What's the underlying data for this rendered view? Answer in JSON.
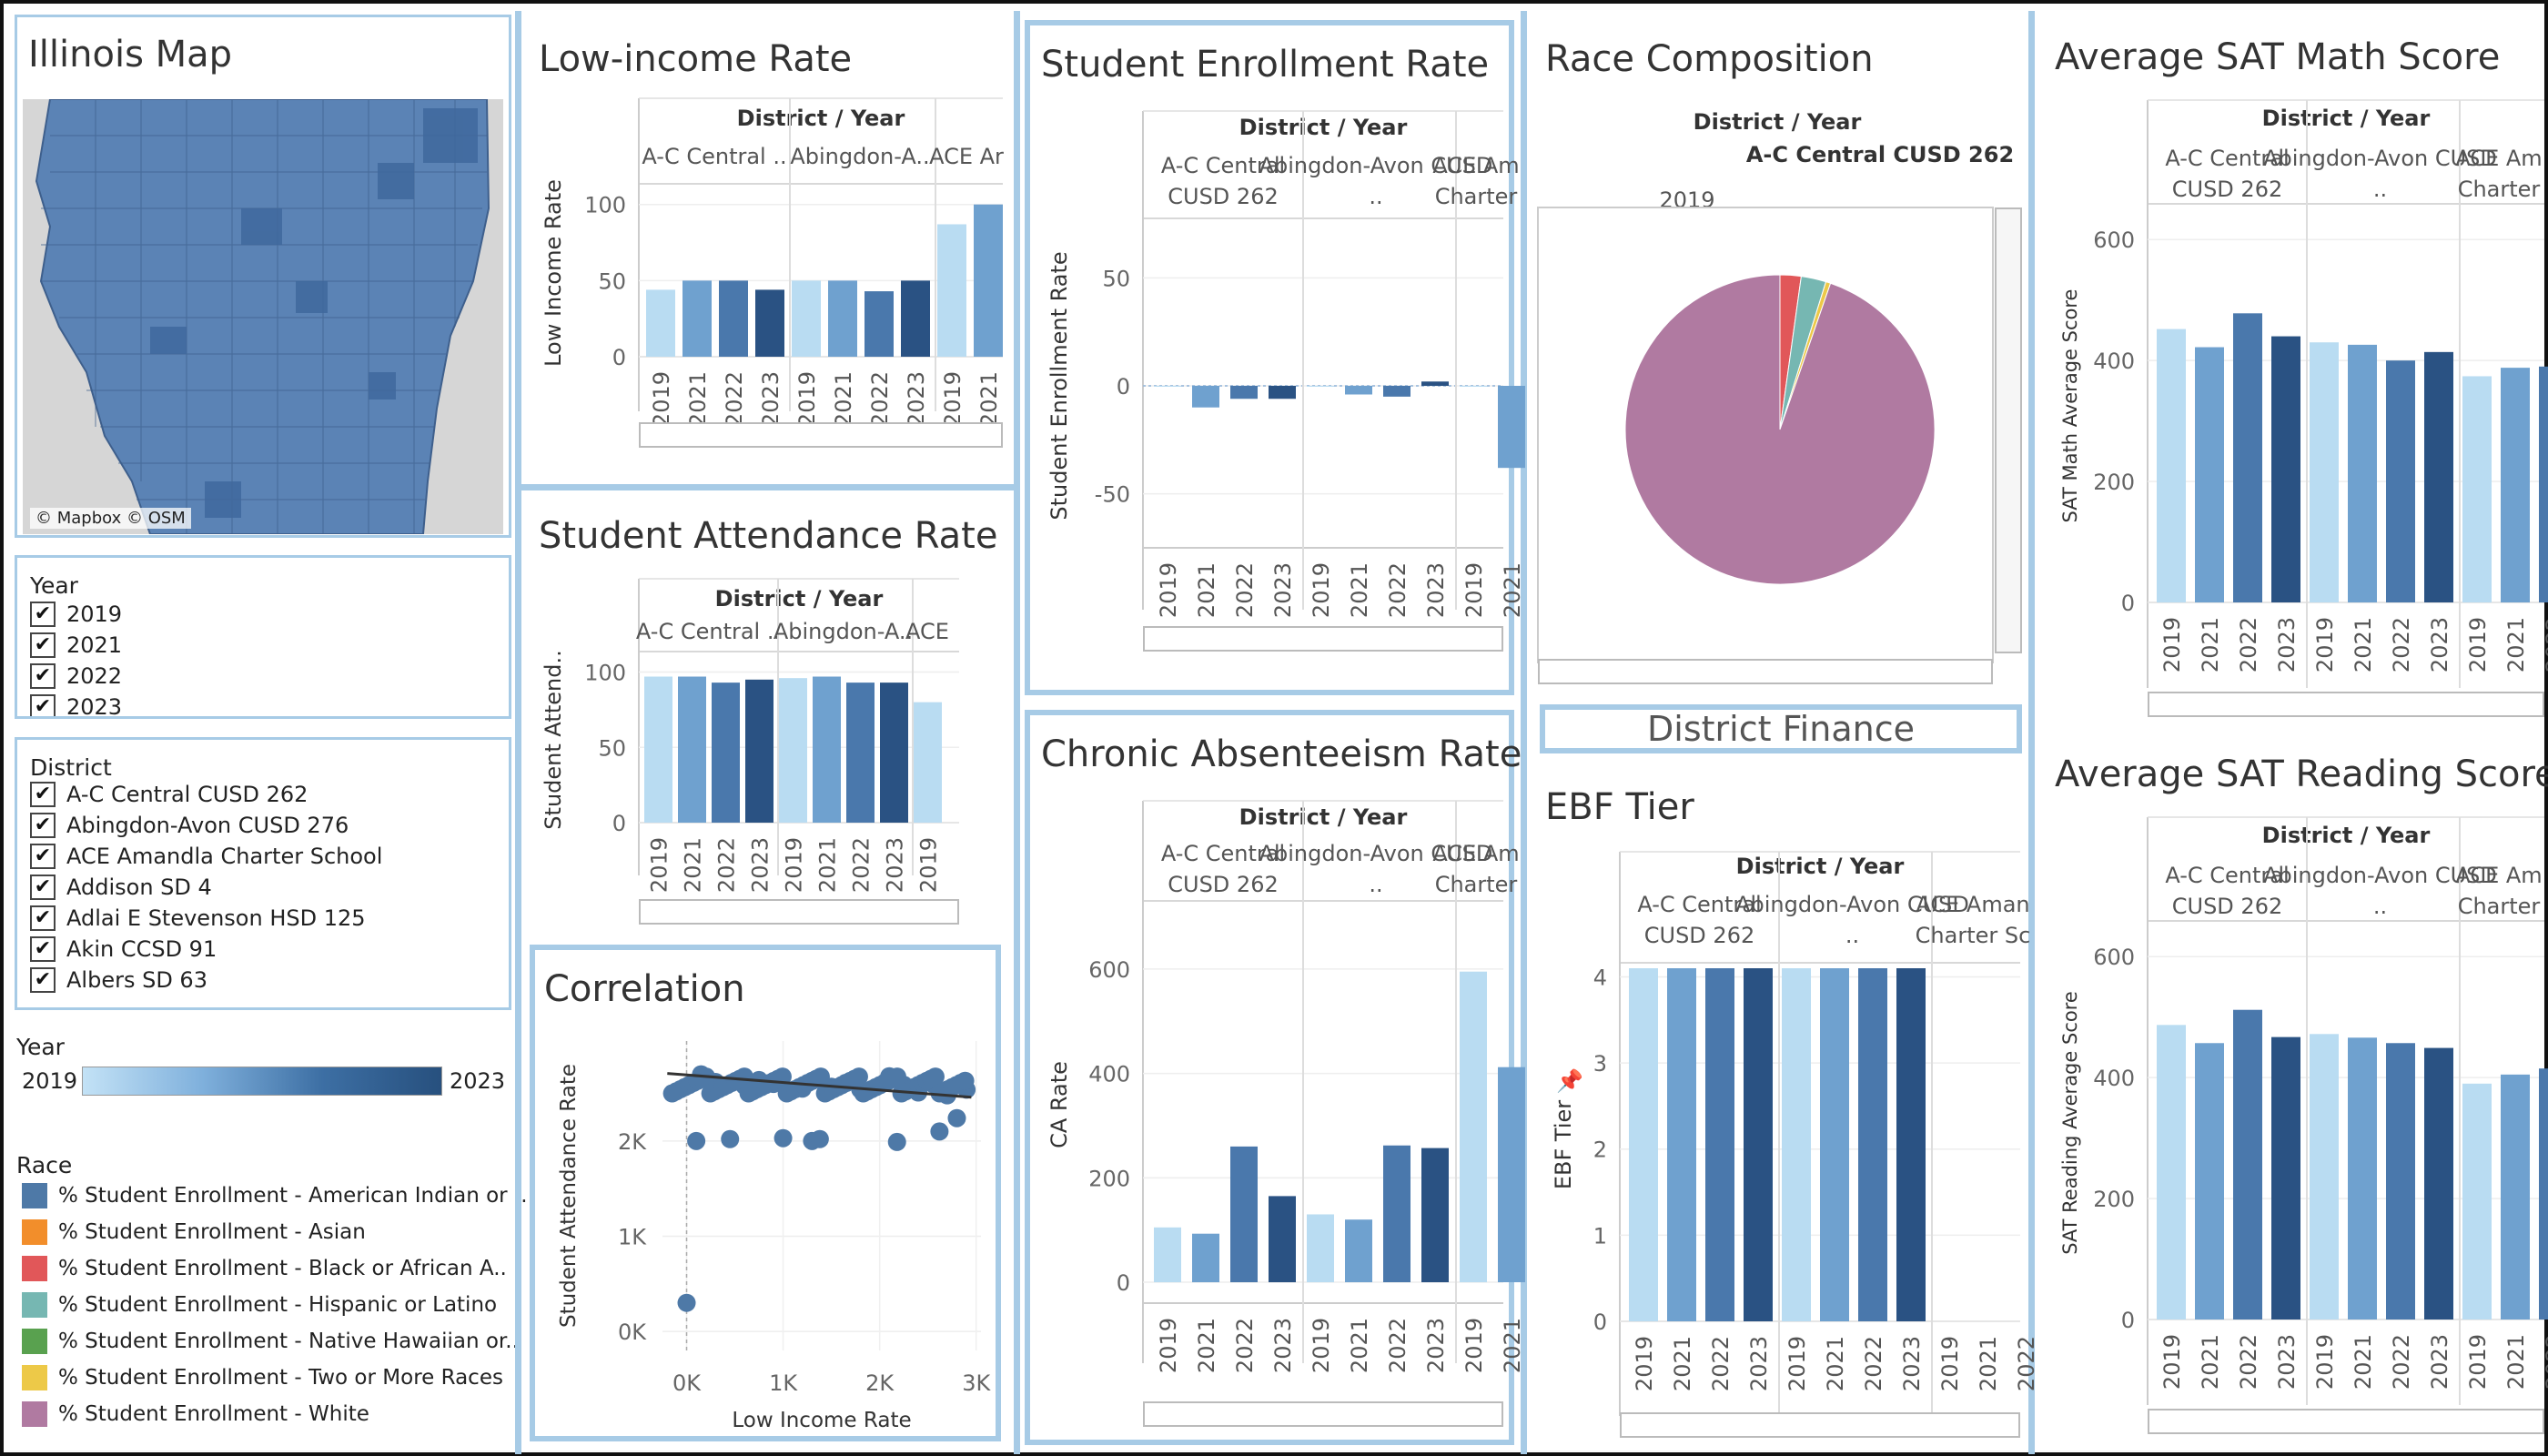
{
  "map": {
    "title": "Illinois Map",
    "attribution": "© Mapbox © OSM"
  },
  "year_filter": {
    "title": "Year",
    "items": [
      "2019",
      "2021",
      "2022",
      "2023"
    ]
  },
  "district_filter": {
    "title": "District",
    "items": [
      "A-C Central CUSD 262",
      "Abingdon-Avon CUSD 276",
      "ACE Amandla Charter School",
      "Addison SD 4",
      "Adlai E Stevenson HSD 125",
      "Akin CCSD 91",
      "Albers SD 63"
    ]
  },
  "year_legend": {
    "title": "Year",
    "min": "2019",
    "max": "2023"
  },
  "race_legend": {
    "title": "Race",
    "items": [
      {
        "label": "% Student Enrollment - American Indian or ..",
        "color": "#4e79a7"
      },
      {
        "label": "% Student Enrollment - Asian",
        "color": "#f28e2b"
      },
      {
        "label": "% Student Enrollment - Black or African A..",
        "color": "#e15759"
      },
      {
        "label": "% Student Enrollment - Hispanic or Latino",
        "color": "#76b7b2"
      },
      {
        "label": "% Student Enrollment - Native Hawaiian or..",
        "color": "#59a14f"
      },
      {
        "label": "% Student Enrollment - Two or More Races",
        "color": "#edc948"
      },
      {
        "label": "% Student Enrollment - White",
        "color": "#b07aa1"
      }
    ]
  },
  "year_colors": {
    "2019": "#b9dcf2",
    "2021": "#6fa1cf",
    "2022": "#4a78ac",
    "2023": "#2a5283"
  },
  "common": {
    "header": "District / Year"
  },
  "finance_button": {
    "label": "District Finance"
  },
  "chart_data": [
    {
      "id": "lowinc",
      "type": "bar",
      "title": "Low-income Rate",
      "ylabel": "Low Income Rate",
      "ylim": [
        0,
        110
      ],
      "yticks": [
        0,
        50,
        100
      ],
      "groups": [
        {
          "label": "A-C Central ..",
          "years": [
            "2019",
            "2021",
            "2022",
            "2023"
          ],
          "values": [
            44,
            50,
            50,
            44
          ]
        },
        {
          "label": "Abingdon-A..",
          "years": [
            "2019",
            "2021",
            "2022",
            "2023"
          ],
          "values": [
            50,
            50,
            43,
            50
          ]
        },
        {
          "label": "ACE Ar",
          "years": [
            "2019",
            "2021"
          ],
          "values": [
            87,
            100
          ]
        }
      ]
    },
    {
      "id": "attend",
      "type": "bar",
      "title": "Student Attendance Rate",
      "ylabel": "Student Attend..",
      "ylim": [
        0,
        110
      ],
      "yticks": [
        0,
        50,
        100
      ],
      "groups": [
        {
          "label": "A-C Central ..",
          "years": [
            "2019",
            "2021",
            "2022",
            "2023"
          ],
          "values": [
            97,
            97,
            93,
            95
          ]
        },
        {
          "label": "Abingdon-A..",
          "years": [
            "2019",
            "2021",
            "2022",
            "2023"
          ],
          "values": [
            96,
            97,
            93,
            93
          ]
        },
        {
          "label": "ACE",
          "years": [
            "2019"
          ],
          "values": [
            80
          ]
        }
      ]
    },
    {
      "id": "enroll",
      "type": "bar",
      "title": "Student Enrollment Rate",
      "ylabel": "Student Enrollment Rate",
      "ylim": [
        -75,
        75
      ],
      "yticks": [
        -50,
        0,
        50
      ],
      "groups": [
        {
          "label": "A-C Central CUSD 262",
          "years": [
            "2019",
            "2021",
            "2022",
            "2023"
          ],
          "values": [
            0,
            -10,
            -6,
            -6
          ]
        },
        {
          "label": "Abingdon-Avon CUSD ..",
          "years": [
            "2019",
            "2021",
            "2022",
            "2023"
          ],
          "values": [
            0,
            -4,
            -5,
            2
          ]
        },
        {
          "label": "ACE Am Charter",
          "years": [
            "2019",
            "2021"
          ],
          "values": [
            0,
            -38
          ]
        }
      ]
    },
    {
      "id": "chronic",
      "type": "bar",
      "title": "Chronic Absenteeism Rate",
      "ylabel": "CA Rate",
      "ylim": [
        -40,
        720
      ],
      "yticks": [
        0,
        200,
        400,
        600
      ],
      "groups": [
        {
          "label": "A-C Central CUSD 262",
          "years": [
            "2019",
            "2021",
            "2022",
            "2023"
          ],
          "values": [
            105,
            93,
            260,
            165
          ]
        },
        {
          "label": "Abingdon-Avon CUSD ..",
          "years": [
            "2019",
            "2021",
            "2022",
            "2023"
          ],
          "values": [
            130,
            120,
            262,
            257
          ]
        },
        {
          "label": "ACE Am Charter",
          "years": [
            "2019",
            "2021"
          ],
          "values": [
            595,
            412
          ]
        }
      ]
    },
    {
      "id": "ebf",
      "type": "bar",
      "title": "EBF Tier",
      "ylabel": "EBF Tier",
      "ylim": [
        0,
        4.1
      ],
      "yticks": [
        0,
        1,
        2,
        3,
        4
      ],
      "groups": [
        {
          "label": "A-C Central CUSD 262",
          "years": [
            "2019",
            "2021",
            "2022",
            "2023"
          ],
          "values": [
            4.1,
            4.1,
            4.1,
            4.1
          ]
        },
        {
          "label": "Abingdon-Avon CUSD ..",
          "years": [
            "2019",
            "2021",
            "2022",
            "2023"
          ],
          "values": [
            4.1,
            4.1,
            4.1,
            4.1
          ]
        },
        {
          "label": "ACE Aman Charter Sc",
          "years": [
            "2019",
            "2021",
            "2022"
          ],
          "values": [
            null,
            null,
            null
          ]
        }
      ]
    },
    {
      "id": "satmath",
      "type": "bar",
      "title": "Average SAT Math Score",
      "ylabel": "SAT Math Average Score",
      "ylim": [
        0,
        650
      ],
      "yticks": [
        0,
        200,
        400,
        600
      ],
      "groups": [
        {
          "label": "A-C Central CUSD 262",
          "years": [
            "2019",
            "2021",
            "2022",
            "2023"
          ],
          "values": [
            452,
            422,
            478,
            440
          ]
        },
        {
          "label": "Abingdon-Avon CUSD ..",
          "years": [
            "2019",
            "2021",
            "2022",
            "2023"
          ],
          "values": [
            430,
            426,
            400,
            414
          ]
        },
        {
          "label": "ACE Am Charter",
          "years": [
            "2019",
            "2021",
            "2022"
          ],
          "values": [
            374,
            388,
            390
          ]
        }
      ]
    },
    {
      "id": "satread",
      "type": "bar",
      "title": "Average SAT Reading Score",
      "ylabel": "SAT Reading Average Score",
      "ylim": [
        0,
        650
      ],
      "yticks": [
        0,
        200,
        400,
        600
      ],
      "groups": [
        {
          "label": "A-C Central CUSD 262",
          "years": [
            "2019",
            "2021",
            "2022",
            "2023"
          ],
          "values": [
            487,
            457,
            512,
            467
          ]
        },
        {
          "label": "Abingdon-Avon CUSD ..",
          "years": [
            "2019",
            "2021",
            "2022",
            "2023"
          ],
          "values": [
            472,
            466,
            457,
            449
          ]
        },
        {
          "label": "ACE Am Charter",
          "years": [
            "2019",
            "2021",
            "2022"
          ],
          "values": [
            390,
            405,
            415
          ]
        }
      ]
    },
    {
      "id": "race",
      "type": "pie",
      "title": "Race Composition",
      "district": "A-C Central CUSD 262",
      "year": "2019",
      "slices": [
        {
          "label": "% Student Enrollment - Black or African A..",
          "value": 2.2,
          "color": "#e15759"
        },
        {
          "label": "% Student Enrollment - Hispanic or Latino",
          "value": 2.6,
          "color": "#76b7b2"
        },
        {
          "label": "% Student Enrollment - Two or More Races",
          "value": 0.5,
          "color": "#edc948"
        },
        {
          "label": "% Student Enrollment - White",
          "value": 94.7,
          "color": "#b07aa1"
        }
      ]
    },
    {
      "id": "corr",
      "type": "scatter",
      "title": "Correlation",
      "xlabel": "Low Income Rate",
      "ylabel": "Student Attendance Rate",
      "xlim": [
        -250,
        3050
      ],
      "ylim": [
        -200,
        3050
      ],
      "xticks": [
        {
          "v": 0,
          "t": "0K"
        },
        {
          "v": 1000,
          "t": "1K"
        },
        {
          "v": 2000,
          "t": "2K"
        },
        {
          "v": 3000,
          "t": "3K"
        }
      ],
      "yticks": [
        {
          "v": 0,
          "t": "0K"
        },
        {
          "v": 1000,
          "t": "1K"
        },
        {
          "v": 2000,
          "t": "2K"
        }
      ],
      "trend": [
        [
          -200,
          2710
        ],
        [
          2950,
          2460
        ]
      ],
      "points": [
        [
          0,
          300
        ],
        [
          100,
          2000
        ],
        [
          450,
          2020
        ],
        [
          1000,
          2030
        ],
        [
          1300,
          2000
        ],
        [
          1380,
          2020
        ],
        [
          2180,
          1990
        ],
        [
          2620,
          2100
        ],
        [
          2800,
          2240
        ],
        [
          300,
          2620
        ],
        [
          600,
          2580
        ],
        [
          900,
          2600
        ],
        [
          1200,
          2550
        ],
        [
          1500,
          2570
        ],
        [
          1800,
          2540
        ],
        [
          2100,
          2680
        ],
        [
          2400,
          2510
        ],
        [
          2700,
          2480
        ],
        [
          2900,
          2540
        ],
        [
          150,
          2700
        ],
        [
          750,
          2640
        ],
        [
          1650,
          2610
        ],
        [
          2250,
          2590
        ],
        [
          2550,
          2600
        ]
      ]
    }
  ]
}
